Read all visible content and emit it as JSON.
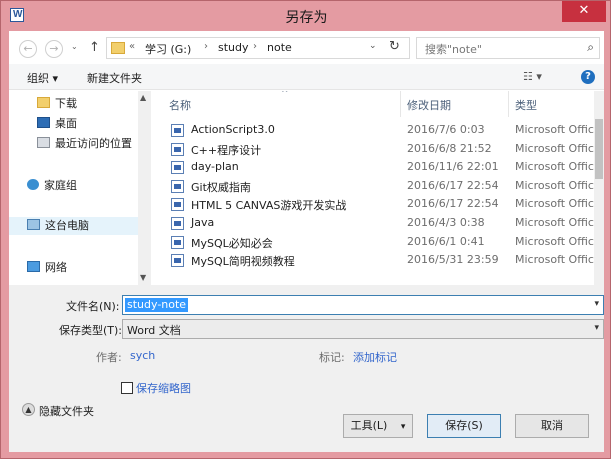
{
  "window": {
    "title": "另存为",
    "close_glyph": "✕"
  },
  "nav": {
    "back": "←",
    "forward": "→",
    "up": "↑",
    "breadcrumb": [
      "«",
      "学习 (G:)",
      "›",
      "study",
      "›",
      "note"
    ],
    "dropdown": "⌄",
    "refresh": "↻",
    "search_placeholder": "搜索\"note\"",
    "search_icon": "⌕"
  },
  "toolbar": {
    "organize": "组织 ▾",
    "new_folder": "新建文件夹",
    "view": "☷ ▾",
    "help": "?"
  },
  "navpane": {
    "items": [
      {
        "label": "下载",
        "icon": "download-folder-icon"
      },
      {
        "label": "桌面",
        "icon": "desktop-icon"
      },
      {
        "label": "最近访问的位置",
        "icon": "recent-places-icon"
      },
      {
        "label": "家庭组",
        "icon": "homegroup-icon"
      },
      {
        "label": "这台电脑",
        "icon": "computer-icon"
      },
      {
        "label": "网络",
        "icon": "network-icon"
      }
    ]
  },
  "filelist": {
    "columns": {
      "name": "名称",
      "date": "修改日期",
      "type": "类型"
    },
    "sort_indicator": "^",
    "rows": [
      {
        "name": "ActionScript3.0",
        "date": "2016/7/6 0:03",
        "type": "Microsoft Office"
      },
      {
        "name": "C++程序设计",
        "date": "2016/6/8 21:52",
        "type": "Microsoft Office"
      },
      {
        "name": "day-plan",
        "date": "2016/11/6 22:01",
        "type": "Microsoft Office"
      },
      {
        "name": "Git权威指南",
        "date": "2016/6/17 22:54",
        "type": "Microsoft Office"
      },
      {
        "name": "HTML 5 CANVAS游戏开发实战",
        "date": "2016/6/17 22:54",
        "type": "Microsoft Office"
      },
      {
        "name": "Java",
        "date": "2016/4/3 0:38",
        "type": "Microsoft Office"
      },
      {
        "name": "MySQL必知必会",
        "date": "2016/6/1 0:41",
        "type": "Microsoft Office"
      },
      {
        "name": "MySQL简明视频教程",
        "date": "2016/5/31 23:59",
        "type": "Microsoft Office"
      }
    ]
  },
  "form": {
    "filename_label": "文件名(N):",
    "filename_value": "study-note",
    "savetype_label": "保存类型(T):",
    "savetype_value": "Word 文档",
    "author_label": "作者:",
    "author_value": "sych",
    "tags_label": "标记:",
    "tags_value": "添加标记",
    "thumbnail_label": "保存缩略图",
    "hide_folders": "隐藏文件夹",
    "tools_button": "工具(L)",
    "tools_arrow": "▾",
    "save_button": "保存(S)",
    "cancel_button": "取消"
  }
}
